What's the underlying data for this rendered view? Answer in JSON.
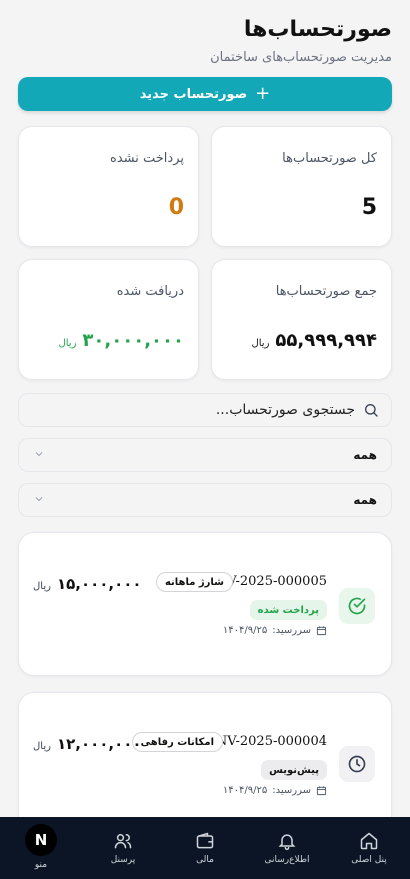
{
  "header": {
    "title": "صورتحساب‌ها",
    "subtitle": "مدیریت صورتحساب‌های ساختمان"
  },
  "new_button": {
    "label": "صورتحساب جدید",
    "icon": "plus-icon"
  },
  "stats": {
    "total_count": {
      "label": "کل صورتحساب‌ها",
      "value": "5"
    },
    "unpaid": {
      "label": "پرداخت نشده",
      "value": "0"
    },
    "total_sum": {
      "label": "جمع صورتحساب‌ها",
      "value": "۵۵,۹۹۹,۹۹۴",
      "currency": "ریال"
    },
    "received": {
      "label": "دریافت شده",
      "value": "۳۰,۰۰۰,۰۰۰",
      "currency": "ریال"
    }
  },
  "search": {
    "placeholder": "جستجوی صورتحساب..."
  },
  "filters": [
    {
      "value": "همه"
    },
    {
      "value": "همه"
    }
  ],
  "invoices": [
    {
      "code": "INV-2025-000005",
      "category": "شارژ ماهانه",
      "status": "پرداخت شده",
      "due_label": "سررسید:",
      "due_date": "۱۴۰۴/۹/۲۵",
      "amount": "۱۵,۰۰۰,۰۰۰",
      "currency": "ریال",
      "status_icon": "check-circle-icon"
    },
    {
      "code": "INV-2025-000004",
      "category": "امکانات رفاهی",
      "status": "پیش‌نویس",
      "due_label": "سررسید:",
      "due_date": "۱۴۰۴/۹/۲۵",
      "amount": "۱۲,۰۰۰,۰۰۰",
      "currency": "ریال",
      "status_icon": "clock-icon"
    }
  ],
  "nav": {
    "home": "پنل اصلی",
    "notifications": "اطلاع‌رسانی",
    "finance": "مالی",
    "staff": "پرسنل",
    "menu": "منو",
    "avatar_letter": "N"
  },
  "colors": {
    "accent": "#12a8b8",
    "paid_green": "#22a34a",
    "unpaid_orange": "#d17a12",
    "nav_bg": "#0b1526"
  }
}
